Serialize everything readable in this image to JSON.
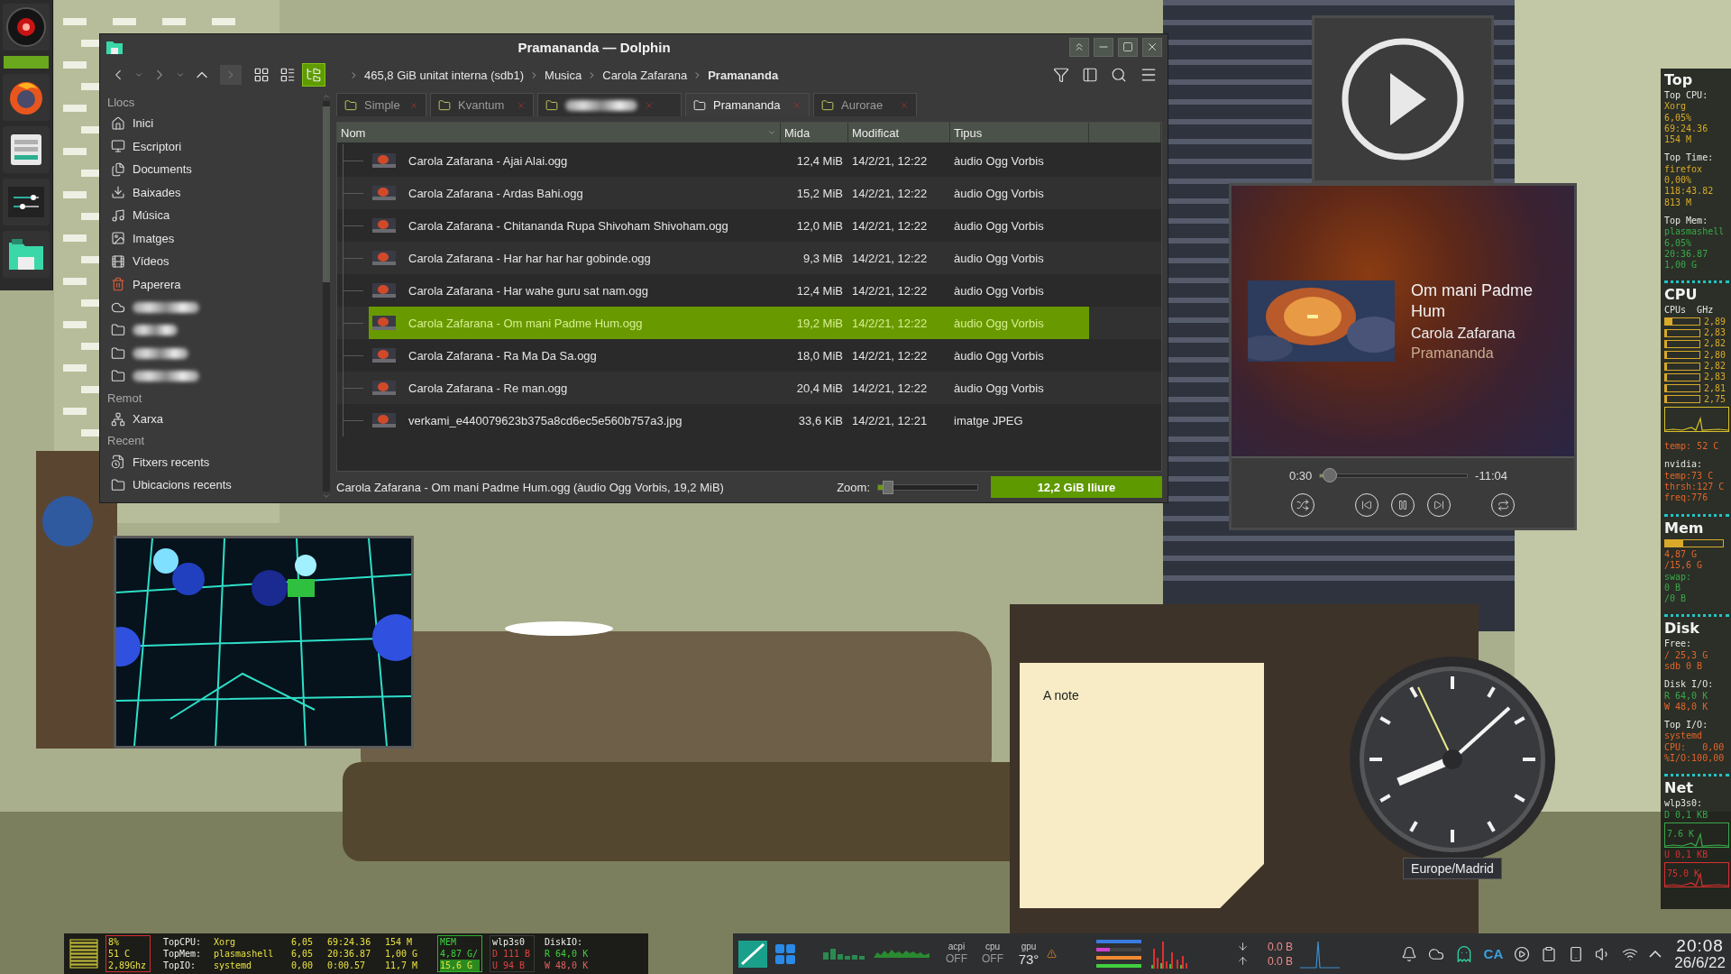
{
  "file_manager": {
    "title": "Pramananda — Dolphin",
    "view_modes": [
      {
        "selected": false
      },
      {
        "selected": false
      },
      {
        "selected": true
      }
    ],
    "breadcrumb": [
      "465,8 GiB unitat interna (sdb1)",
      "Musica",
      "Carola Zafarana",
      "Pramananda"
    ],
    "places": [
      {
        "heading": "Llocs",
        "items": [
          {
            "kind": "place",
            "label": "Inici"
          },
          {
            "kind": "place",
            "label": "Escriptori"
          },
          {
            "kind": "place",
            "label": "Documents"
          },
          {
            "kind": "place",
            "label": "Baixades"
          },
          {
            "kind": "place",
            "label": "Música"
          },
          {
            "kind": "place",
            "label": "Imatges"
          },
          {
            "kind": "place",
            "label": "Vídeos"
          },
          {
            "kind": "place",
            "label": "Paperera"
          },
          {
            "kind": "blurred"
          },
          {
            "kind": "blurred"
          },
          {
            "kind": "blurred"
          },
          {
            "kind": "blurred"
          }
        ]
      },
      {
        "heading": "Remot",
        "items": [
          {
            "kind": "place",
            "label": "Xarxa"
          }
        ]
      },
      {
        "heading": "Recent",
        "items": [
          {
            "kind": "place",
            "label": "Fitxers recents"
          },
          {
            "kind": "place",
            "label": "Ubicacions recents"
          }
        ]
      }
    ],
    "tabs": [
      {
        "kind": "folder",
        "label": "Simple",
        "selected": false
      },
      {
        "kind": "folder",
        "label": "Kvantum",
        "selected": false
      },
      {
        "kind": "blurred",
        "selected": false
      },
      {
        "kind": "folder",
        "label": "Pramananda",
        "selected": true
      },
      {
        "kind": "folder",
        "label": "Aurorae",
        "selected": false
      }
    ],
    "columns": [
      "Nom",
      "Mida",
      "Modificat",
      "Tipus"
    ],
    "rows": [
      {
        "name": "Carola Zafarana - Ajai Alai.ogg",
        "size": "12,4 MiB",
        "modified": "14/2/21, 12:22",
        "type": "àudio Ogg Vorbis",
        "selected": false
      },
      {
        "name": "Carola Zafarana - Ardas Bahi.ogg",
        "size": "15,2 MiB",
        "modified": "14/2/21, 12:22",
        "type": "àudio Ogg Vorbis",
        "selected": false
      },
      {
        "name": "Carola Zafarana - Chitananda Rupa Shivoham Shivoham.ogg",
        "size": "12,0 MiB",
        "modified": "14/2/21, 12:22",
        "type": "àudio Ogg Vorbis",
        "selected": false
      },
      {
        "name": "Carola Zafarana - Har har har har gobinde.ogg",
        "size": "9,3 MiB",
        "modified": "14/2/21, 12:22",
        "type": "àudio Ogg Vorbis",
        "selected": false
      },
      {
        "name": "Carola Zafarana - Har wahe guru sat nam.ogg",
        "size": "12,4 MiB",
        "modified": "14/2/21, 12:22",
        "type": "àudio Ogg Vorbis",
        "selected": false
      },
      {
        "name": "Carola Zafarana - Om mani Padme Hum.ogg",
        "size": "19,2 MiB",
        "modified": "14/2/21, 12:22",
        "type": "àudio Ogg Vorbis",
        "selected": true
      },
      {
        "name": "Carola Zafarana - Ra Ma Da Sa.ogg",
        "size": "18,0 MiB",
        "modified": "14/2/21, 12:22",
        "type": "àudio Ogg Vorbis",
        "selected": false
      },
      {
        "name": "Carola Zafarana - Re man.ogg",
        "size": "20,4 MiB",
        "modified": "14/2/21, 12:22",
        "type": "àudio Ogg Vorbis",
        "selected": false
      },
      {
        "name": "verkami_e440079623b375a8cd6ec5e560b757a3.jpg",
        "size": "33,6 KiB",
        "modified": "14/2/21, 12:21",
        "type": "imatge JPEG",
        "selected": false
      }
    ],
    "status": "Carola Zafarana - Om mani Padme Hum.ogg (àudio Ogg Vorbis, 19,2 MiB)",
    "zoom_label": "Zoom:",
    "zoom": {
      "level": 0.08
    },
    "free_space": "12,2 GiB lliure"
  },
  "player": {
    "title": "Om mani Padme Hum",
    "artist": "Carola Zafarana",
    "album": "Pramananda",
    "elapsed": "0:30",
    "remaining": "-11:04",
    "level": 0.043
  },
  "note": {
    "text": "A note"
  },
  "clock": {
    "timezone": "Europe/Madrid"
  },
  "side_monitor": [
    {
      "heading": "Top",
      "groups": [
        [
          {
            "kind": "label",
            "text": "Top CPU:"
          },
          {
            "kind": "value",
            "text": "Xorg"
          },
          {
            "kind": "value",
            "text": "6,05%"
          },
          {
            "kind": "value",
            "text": "69:24.36"
          },
          {
            "kind": "value",
            "text": "154 M"
          }
        ],
        [
          {
            "kind": "label",
            "text": "Top Time:"
          },
          {
            "kind": "value",
            "text": "firefox"
          },
          {
            "kind": "value",
            "text": "0,00%"
          },
          {
            "kind": "value",
            "text": "118:43.82"
          },
          {
            "kind": "value",
            "text": "813 M"
          }
        ],
        [
          {
            "kind": "label",
            "text": "Top Mem:"
          },
          {
            "kind": "good",
            "text": "plasmashell"
          },
          {
            "kind": "good",
            "text": "6,05%"
          },
          {
            "kind": "good",
            "text": "20:36.87"
          },
          {
            "kind": "good",
            "text": "1,00 G"
          }
        ]
      ]
    },
    {
      "heading": "CPU",
      "groups": [
        [
          {
            "kind": "label",
            "text": "CPUs  GHz"
          },
          {
            "kind": "meter",
            "text": "2,89",
            "level": 0.2
          },
          {
            "kind": "meter",
            "text": "2,83",
            "level": 0.04
          },
          {
            "kind": "meter",
            "text": "2,82",
            "level": 0.04
          },
          {
            "kind": "meter",
            "text": "2,80",
            "level": 0.04
          },
          {
            "kind": "meter",
            "text": "2,82",
            "level": 0.04
          },
          {
            "kind": "meter",
            "text": "2,83",
            "level": 0.04
          },
          {
            "kind": "meter",
            "text": "2,81",
            "level": 0.04
          },
          {
            "kind": "meter",
            "text": "2,75",
            "level": 0.04
          },
          {
            "kind": "graph"
          }
        ],
        [
          {
            "kind": "warn",
            "text": "temp: 52 C"
          }
        ],
        [
          {
            "kind": "label",
            "text": "nvidia:"
          },
          {
            "kind": "warn",
            "text": "temp:73 C"
          },
          {
            "kind": "warn",
            "text": "thrsh:127 C"
          },
          {
            "kind": "warn",
            "text": "freq:776"
          }
        ]
      ]
    },
    {
      "heading": "Mem",
      "groups": [
        [
          {
            "kind": "meter",
            "level": 0.31
          },
          {
            "kind": "warn",
            "text": "4,87 G"
          },
          {
            "kind": "warn",
            "text": "/15,6 G"
          },
          {
            "kind": "good",
            "text": "swap:"
          },
          {
            "kind": "good",
            "text": "0 B"
          },
          {
            "kind": "good",
            "text": "/0 B"
          }
        ]
      ]
    },
    {
      "heading": "Disk",
      "groups": [
        [
          {
            "kind": "label",
            "text": "Free:"
          },
          {
            "kind": "warn",
            "text": "/ 25,3 G"
          },
          {
            "kind": "warn",
            "text": "sdb 0 B"
          }
        ],
        [
          {
            "kind": "label",
            "text": "Disk I/O:"
          },
          {
            "kind": "good",
            "text": "R 64,0 K"
          },
          {
            "kind": "warn",
            "text": "W 48,0 K"
          }
        ],
        [
          {
            "kind": "label",
            "text": "Top I/O:"
          },
          {
            "kind": "warn",
            "text": "systemd"
          },
          {
            "kind": "warn",
            "text": "CPU:   0,00"
          },
          {
            "kind": "warn",
            "text": "%I/O:100,00"
          }
        ]
      ]
    },
    {
      "heading": "Net",
      "groups": [
        [
          {
            "kind": "label",
            "text": "wlp3s0:"
          },
          {
            "kind": "good",
            "text": "D 0,1 KB"
          },
          {
            "kind": "graph",
            "text": "7.6 K"
          },
          {
            "kind": "alert",
            "text": "U 0,1 KB"
          },
          {
            "kind": "graph",
            "text": "75.0 K"
          }
        ]
      ]
    }
  ],
  "bottom_monitor": {
    "cpu": [
      "8%",
      "51 C",
      "2,89Ghz"
    ],
    "top": [
      {
        "label": "TopCPU:",
        "process": "Xorg",
        "cpu": "6,05",
        "time": "69:24.36",
        "mem": "154 M"
      },
      {
        "label": "TopMem:",
        "process": "plasmashell",
        "cpu": "6,05",
        "time": "20:36.87",
        "mem": "1,00 G"
      },
      {
        "label": "TopIO:",
        "process": "systemd",
        "cpu": "0,00",
        "time": "0:00.57",
        "mem": "11,7 M"
      }
    ],
    "mem": [
      "MEM",
      "4,87 G/",
      "15,6 G"
    ],
    "net": [
      "wlp3s0",
      "D 111 B",
      "U 94 B"
    ],
    "disk": [
      "DiskIO:",
      "R 64,0 K",
      "W 48,0 K"
    ]
  },
  "panel": {
    "sensors": [
      {
        "label": "acpi",
        "value": "OFF"
      },
      {
        "label": "cpu",
        "value": "OFF"
      },
      {
        "label": "gpu",
        "value": "73°"
      }
    ],
    "meters": [
      {
        "level": 1,
        "color": "#3a7be0"
      },
      {
        "level": 0.3,
        "color": "#d040d0"
      },
      {
        "level": 1,
        "color": "#f08a30"
      },
      {
        "level": 1,
        "color": "#40d040"
      }
    ],
    "download": "0.0 B",
    "upload": "0.0 B",
    "keyboard_layout": "CA",
    "time": "20:08",
    "date": "26/6/22"
  }
}
